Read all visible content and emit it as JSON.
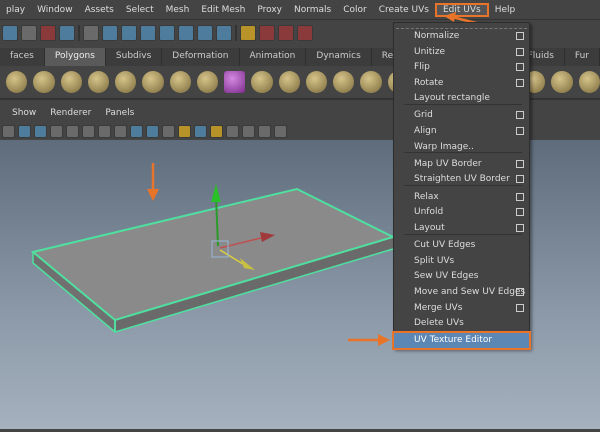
{
  "menubar": [
    "play",
    "Window",
    "Assets",
    "Select",
    "Mesh",
    "Edit Mesh",
    "Proxy",
    "Normals",
    "Color",
    "Create UVs",
    "Edit UVs",
    "Help"
  ],
  "shelf_tabs": [
    "faces",
    "Polygons",
    "Subdivs",
    "Deformation",
    "Animation",
    "Dynamics",
    "Rendering",
    "F",
    "Fluids",
    "Fur"
  ],
  "panel_menu": [
    "Show",
    "Renderer",
    "Panels"
  ],
  "edit_uvs_menu": [
    {
      "label": "Normalize",
      "option_box": true
    },
    {
      "label": "Unitize",
      "option_box": true
    },
    {
      "label": "Flip",
      "option_box": true
    },
    {
      "label": "Rotate",
      "option_box": true
    },
    {
      "label": "Layout rectangle",
      "option_box": false
    },
    {
      "label": "Grid",
      "option_box": true
    },
    {
      "label": "Align",
      "option_box": true
    },
    {
      "label": "Warp Image..",
      "option_box": false
    },
    {
      "label": "Map UV Border",
      "option_box": true
    },
    {
      "label": "Straighten UV Border",
      "option_box": true
    },
    {
      "label": "Relax",
      "option_box": true
    },
    {
      "label": "Unfold",
      "option_box": true
    },
    {
      "label": "Layout",
      "option_box": true
    },
    {
      "label": "Cut UV Edges",
      "option_box": false
    },
    {
      "label": "Split UVs",
      "option_box": false
    },
    {
      "label": "Sew UV Edges",
      "option_box": false
    },
    {
      "label": "Move and Sew UV Edges",
      "option_box": true
    },
    {
      "label": "Merge UVs",
      "option_box": true
    },
    {
      "label": "Delete UVs",
      "option_box": false
    },
    {
      "label": "UV Texture Editor",
      "option_box": false,
      "highlighted": true
    }
  ],
  "colors": {
    "accent": "#e8742a",
    "selection_wire": "#4fe0a0",
    "highlight": "#5c86b4"
  }
}
